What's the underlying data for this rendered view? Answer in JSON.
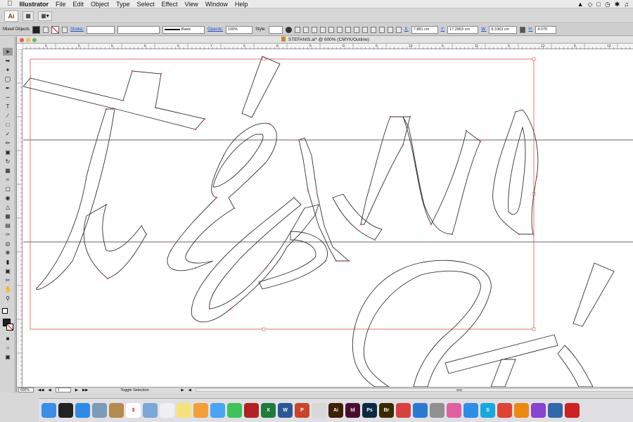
{
  "menubar": {
    "app_name": "Illustrator",
    "items": [
      "File",
      "Edit",
      "Object",
      "Type",
      "Select",
      "Effect",
      "View",
      "Window",
      "Help"
    ]
  },
  "appbar": {
    "logo": "Ai"
  },
  "control_bar": {
    "selection": "Mixed Objects",
    "stroke_label": "Stroke:",
    "brush_style": "Basic",
    "opacity_label": "Opacity:",
    "opacity_value": "100%",
    "style_label": "Style:",
    "x_label": "X:",
    "x_value": "7.881 cm",
    "y_label": "Y:",
    "y_value": "17.2963 cm",
    "w_label": "W:",
    "w_value": "8.1063 cm",
    "h_label": "H:",
    "h_value": "4.075"
  },
  "document": {
    "title": "STEFANIS.ai* @ 600% (CMYK/Outline)",
    "ruler_ticks": [
      "5",
      "5",
      "5",
      "6",
      "5",
      "7",
      "5",
      "8",
      "5",
      "9",
      "5",
      "10",
      "5",
      "11",
      "5",
      "12",
      "5",
      "13"
    ]
  },
  "status_bar": {
    "zoom": "600%",
    "artboard": "1",
    "status_text": "Toggle Selection"
  },
  "dock": {
    "apps": [
      {
        "name": "finder",
        "label": "",
        "color": "#3b8ee8"
      },
      {
        "name": "dashboard",
        "label": "",
        "color": "#222222"
      },
      {
        "name": "safari",
        "label": "",
        "color": "#2f8ae6"
      },
      {
        "name": "preview",
        "label": "",
        "color": "#7b9bb8"
      },
      {
        "name": "contacts",
        "label": "",
        "color": "#b58a4f"
      },
      {
        "name": "calendar",
        "label": "3",
        "color": "#ffffff"
      },
      {
        "name": "photos-viewer",
        "label": "",
        "color": "#7aa7d6"
      },
      {
        "name": "pages",
        "label": "",
        "color": "#f0f0f0"
      },
      {
        "name": "notes",
        "label": "",
        "color": "#f6e27a"
      },
      {
        "name": "photos",
        "label": "",
        "color": "#f2a03a"
      },
      {
        "name": "messages",
        "label": "",
        "color": "#4aa3f3"
      },
      {
        "name": "facetime",
        "label": "",
        "color": "#3cc35a"
      },
      {
        "name": "photo-booth",
        "label": "",
        "color": "#b22222"
      },
      {
        "name": "excel",
        "label": "X",
        "color": "#1f7a3d"
      },
      {
        "name": "word",
        "label": "W",
        "color": "#2b5797"
      },
      {
        "name": "powerpoint",
        "label": "P",
        "color": "#c9452a"
      },
      {
        "name": "acrobat",
        "label": "",
        "color": "#d8d8d8"
      },
      {
        "name": "illustrator",
        "label": "Ai",
        "color": "#3d1f00"
      },
      {
        "name": "indesign",
        "label": "Id",
        "color": "#4a0d30"
      },
      {
        "name": "photoshop",
        "label": "Ps",
        "color": "#0d2a44"
      },
      {
        "name": "bridge",
        "label": "Br",
        "color": "#3a2a00"
      },
      {
        "name": "crashplan",
        "label": "",
        "color": "#d84040"
      },
      {
        "name": "dropbox",
        "label": "",
        "color": "#2a7ad0"
      },
      {
        "name": "printer",
        "label": "",
        "color": "#909090"
      },
      {
        "name": "itunes",
        "label": "",
        "color": "#e060a0"
      },
      {
        "name": "app-store",
        "label": "",
        "color": "#2d8ee8"
      },
      {
        "name": "skype",
        "label": "S",
        "color": "#17a8e0"
      },
      {
        "name": "chrome",
        "label": "",
        "color": "#dd4433"
      },
      {
        "name": "vlc",
        "label": "",
        "color": "#ee8811"
      },
      {
        "name": "setapp",
        "label": "",
        "color": "#8844cc"
      },
      {
        "name": "vectorworks",
        "label": "",
        "color": "#3366aa"
      },
      {
        "name": "parallels",
        "label": "",
        "color": "#cc2222"
      }
    ]
  }
}
